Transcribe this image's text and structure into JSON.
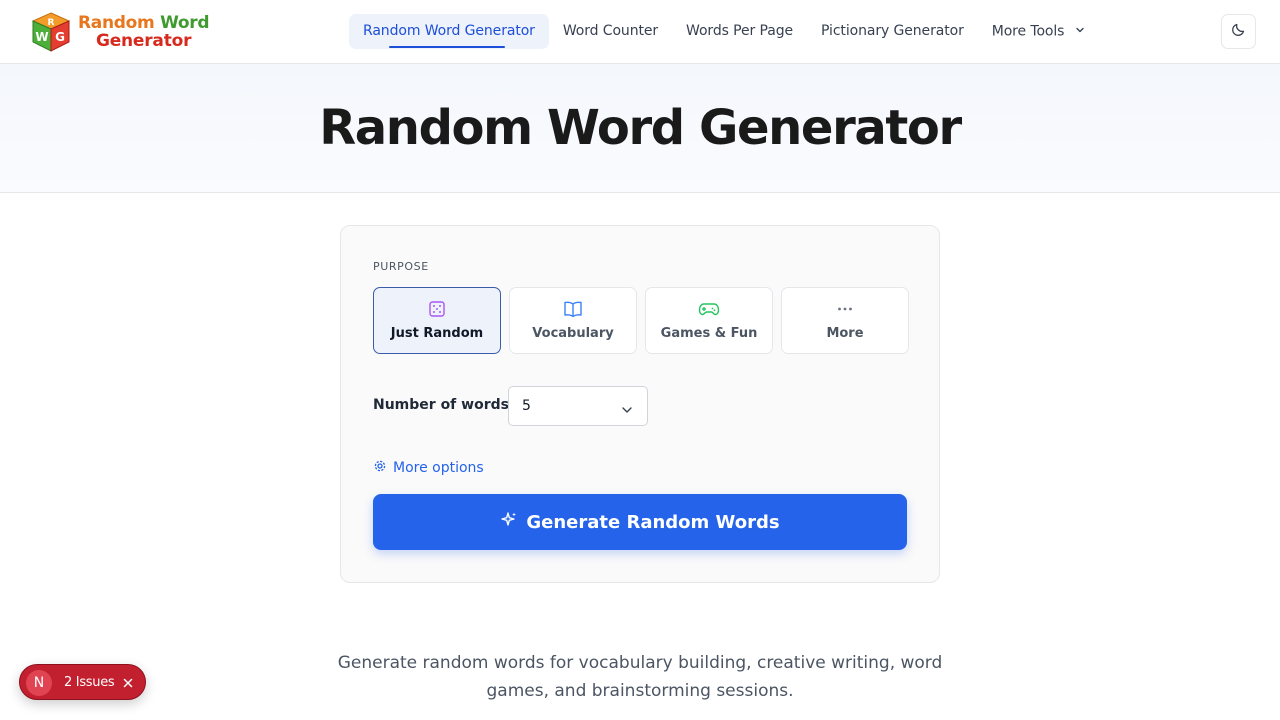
{
  "header": {
    "logo": {
      "line1_a": "Random",
      "line1_b": "Word",
      "line2": "Generator",
      "cube_letters": [
        "R",
        "W",
        "G"
      ]
    },
    "nav": [
      {
        "label": "Random Word Generator",
        "active": true
      },
      {
        "label": "Word Counter"
      },
      {
        "label": "Words Per Page"
      },
      {
        "label": "Pictionary Generator"
      },
      {
        "label": "More Tools",
        "icon": "chevron-down-icon"
      }
    ],
    "theme_toggle_icon": "moon-icon"
  },
  "hero": {
    "title": "Random Word Generator"
  },
  "form": {
    "purpose_label": "PURPOSE",
    "purposes": [
      {
        "label": "Just Random",
        "icon": "dice-icon",
        "icon_color": "#a855f7",
        "selected": true
      },
      {
        "label": "Vocabulary",
        "icon": "book-icon",
        "icon_color": "#3b82f6"
      },
      {
        "label": "Games & Fun",
        "icon": "gamepad-icon",
        "icon_color": "#22c55e"
      },
      {
        "label": "More",
        "icon": "ellipsis-icon",
        "icon_color": "#6b7280"
      }
    ],
    "number_label": "Number of words",
    "number_value": "5",
    "more_options": "More options",
    "generate_label": "Generate Random Words"
  },
  "description": "Generate random words for vocabulary building, creative writing, word games, and brainstorming sessions.",
  "issues": {
    "avatar": "N",
    "label": "2 Issues"
  },
  "colors": {
    "accent": "#2563eb",
    "issues_bg": "#c21f2f"
  }
}
